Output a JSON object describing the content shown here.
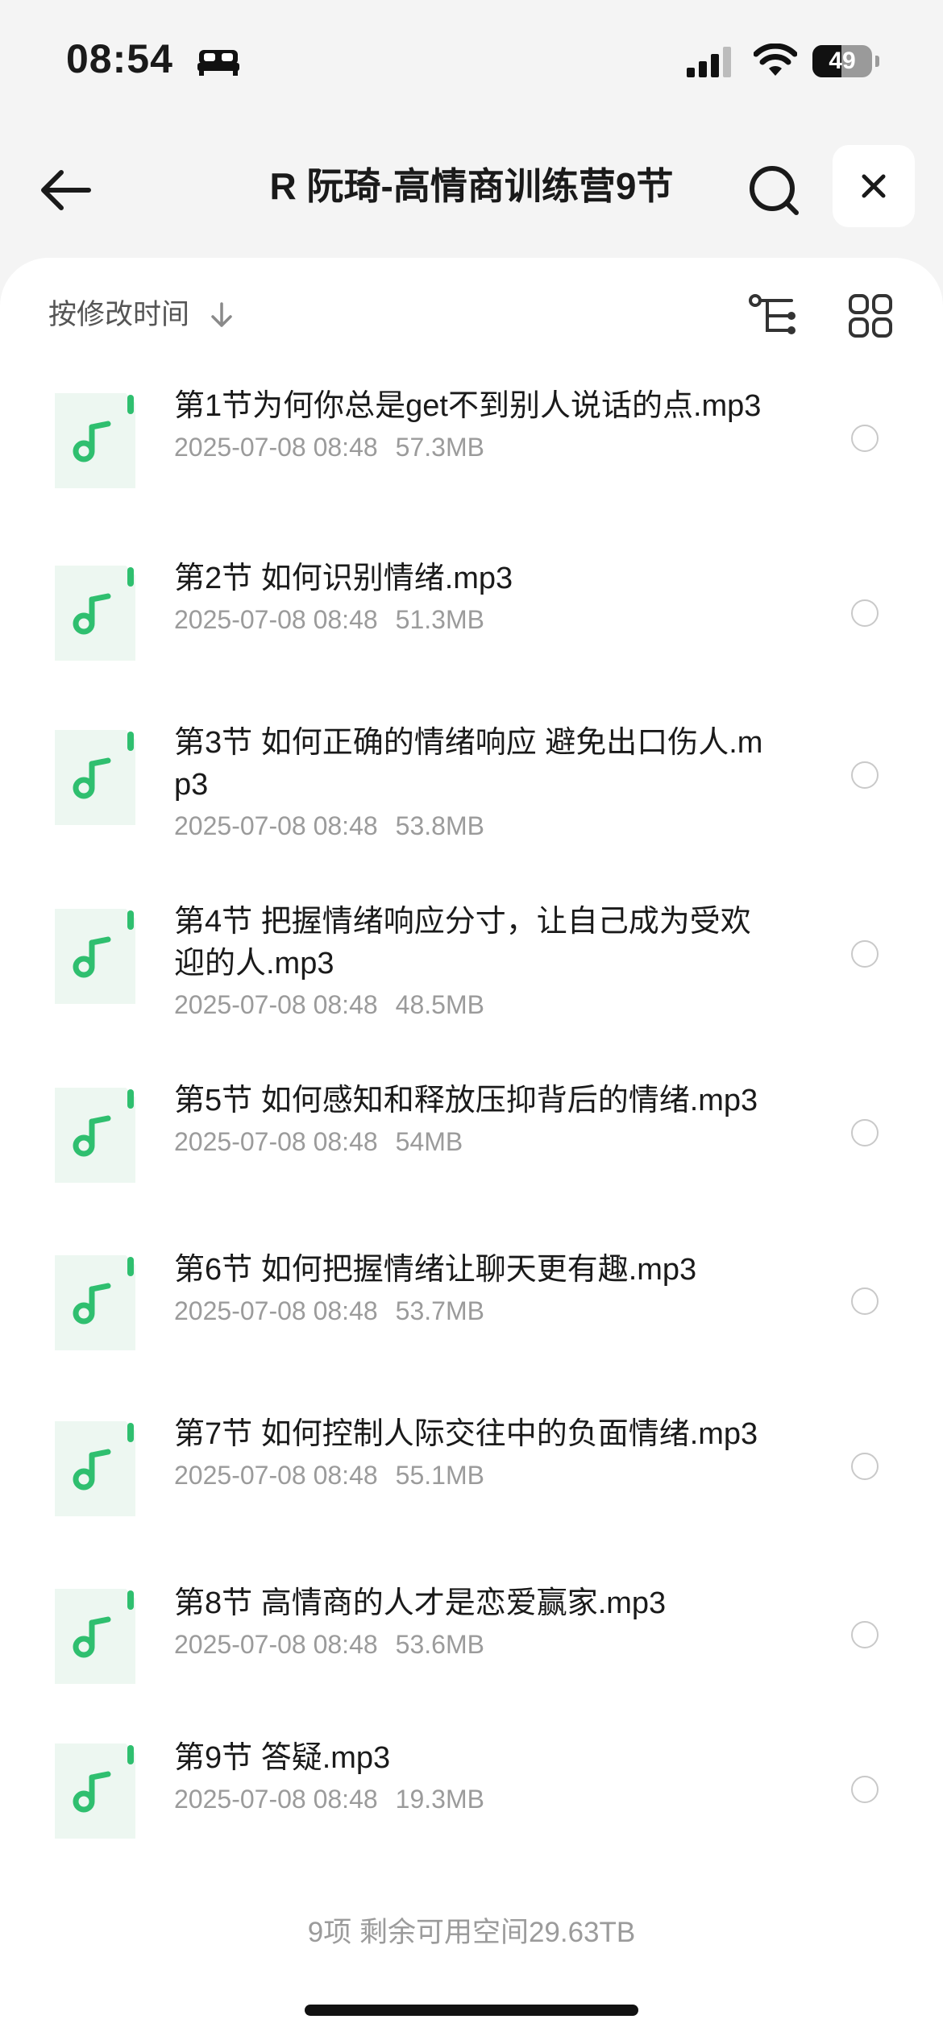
{
  "status_bar": {
    "time": "08:54",
    "battery": "49",
    "battery_level": 0.49
  },
  "header": {
    "title": "R 阮琦-高情商训练营9节"
  },
  "sort": {
    "label": "按修改时间"
  },
  "files": [
    {
      "name": "第1节为何你总是get不到别人说话的点.mp3",
      "date": "2025-07-08 08:48",
      "size": "57.3MB"
    },
    {
      "name": "第2节 如何识别情绪.mp3",
      "date": "2025-07-08 08:48",
      "size": "51.3MB"
    },
    {
      "name": "第3节 如何正确的情绪响应 避免出口伤人.mp3",
      "date": "2025-07-08 08:48",
      "size": "53.8MB"
    },
    {
      "name": "第4节 把握情绪响应分寸，让自己成为受欢迎的人.mp3",
      "date": "2025-07-08 08:48",
      "size": "48.5MB"
    },
    {
      "name": "第5节 如何感知和释放压抑背后的情绪.mp3",
      "date": "2025-07-08 08:48",
      "size": "54MB"
    },
    {
      "name": "第6节 如何把握情绪让聊天更有趣.mp3",
      "date": "2025-07-08 08:48",
      "size": "53.7MB"
    },
    {
      "name": "第7节 如何控制人际交往中的负面情绪.mp3",
      "date": "2025-07-08 08:48",
      "size": "55.1MB"
    },
    {
      "name": "第8节 高情商的人才是恋爱赢家.mp3",
      "date": "2025-07-08 08:48",
      "size": "53.6MB"
    },
    {
      "name": "第9节 答疑.mp3",
      "date": "2025-07-08 08:48",
      "size": "19.3MB"
    }
  ],
  "footer": {
    "summary": "9项 剩余可用空间29.63TB"
  },
  "colors": {
    "accent": "#2fbf6f",
    "icon_bg": "#edf7f1",
    "meta_text": "#9b9b9b"
  }
}
